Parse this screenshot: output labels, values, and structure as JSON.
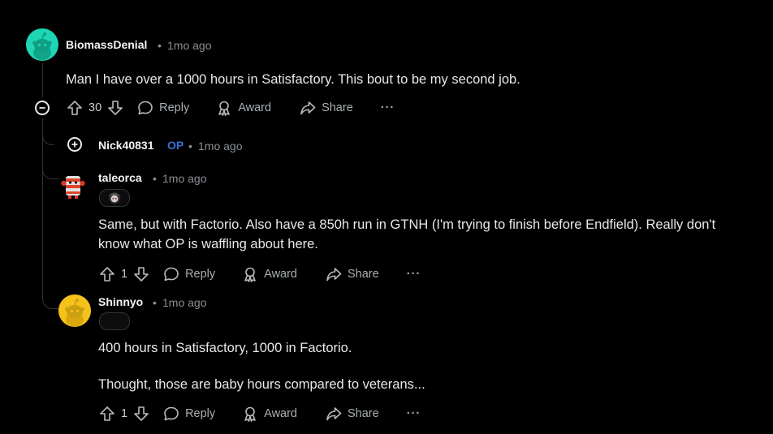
{
  "comments": [
    {
      "username": "BiomassDenial",
      "time": "1mo ago",
      "body": "Man I have over a 1000 hours in Satisfactory. This bout to be my second job.",
      "votes": "30",
      "reply": "Reply",
      "award": "Award",
      "share": "Share",
      "avatar_color": "#1ed6b3"
    },
    {
      "username": "Nick40831",
      "op_badge": "OP",
      "time": "1mo ago"
    },
    {
      "username": "taleorca",
      "time": "1mo ago",
      "body_1": "Same, but with Factorio. Also have a 850h run in GTNH (I'm trying to finish before Endfield). Really don't",
      "body_2": "know what OP is waffling about here.",
      "votes": "1",
      "reply": "Reply",
      "award": "Award",
      "share": "Share"
    },
    {
      "username": "Shinnyo",
      "time": "1mo ago",
      "para_1": "400 hours in Satisfactory, 1000 in Factorio.",
      "para_2": "Thought, those are baby hours compared to veterans...",
      "votes": "1",
      "reply": "Reply",
      "award": "Award",
      "share": "Share",
      "avatar_color": "#f4c21b"
    }
  ],
  "separator": "•",
  "more": "···",
  "colors": {
    "background": "#000000",
    "op": "#3b6fd6",
    "line": "#343536"
  }
}
